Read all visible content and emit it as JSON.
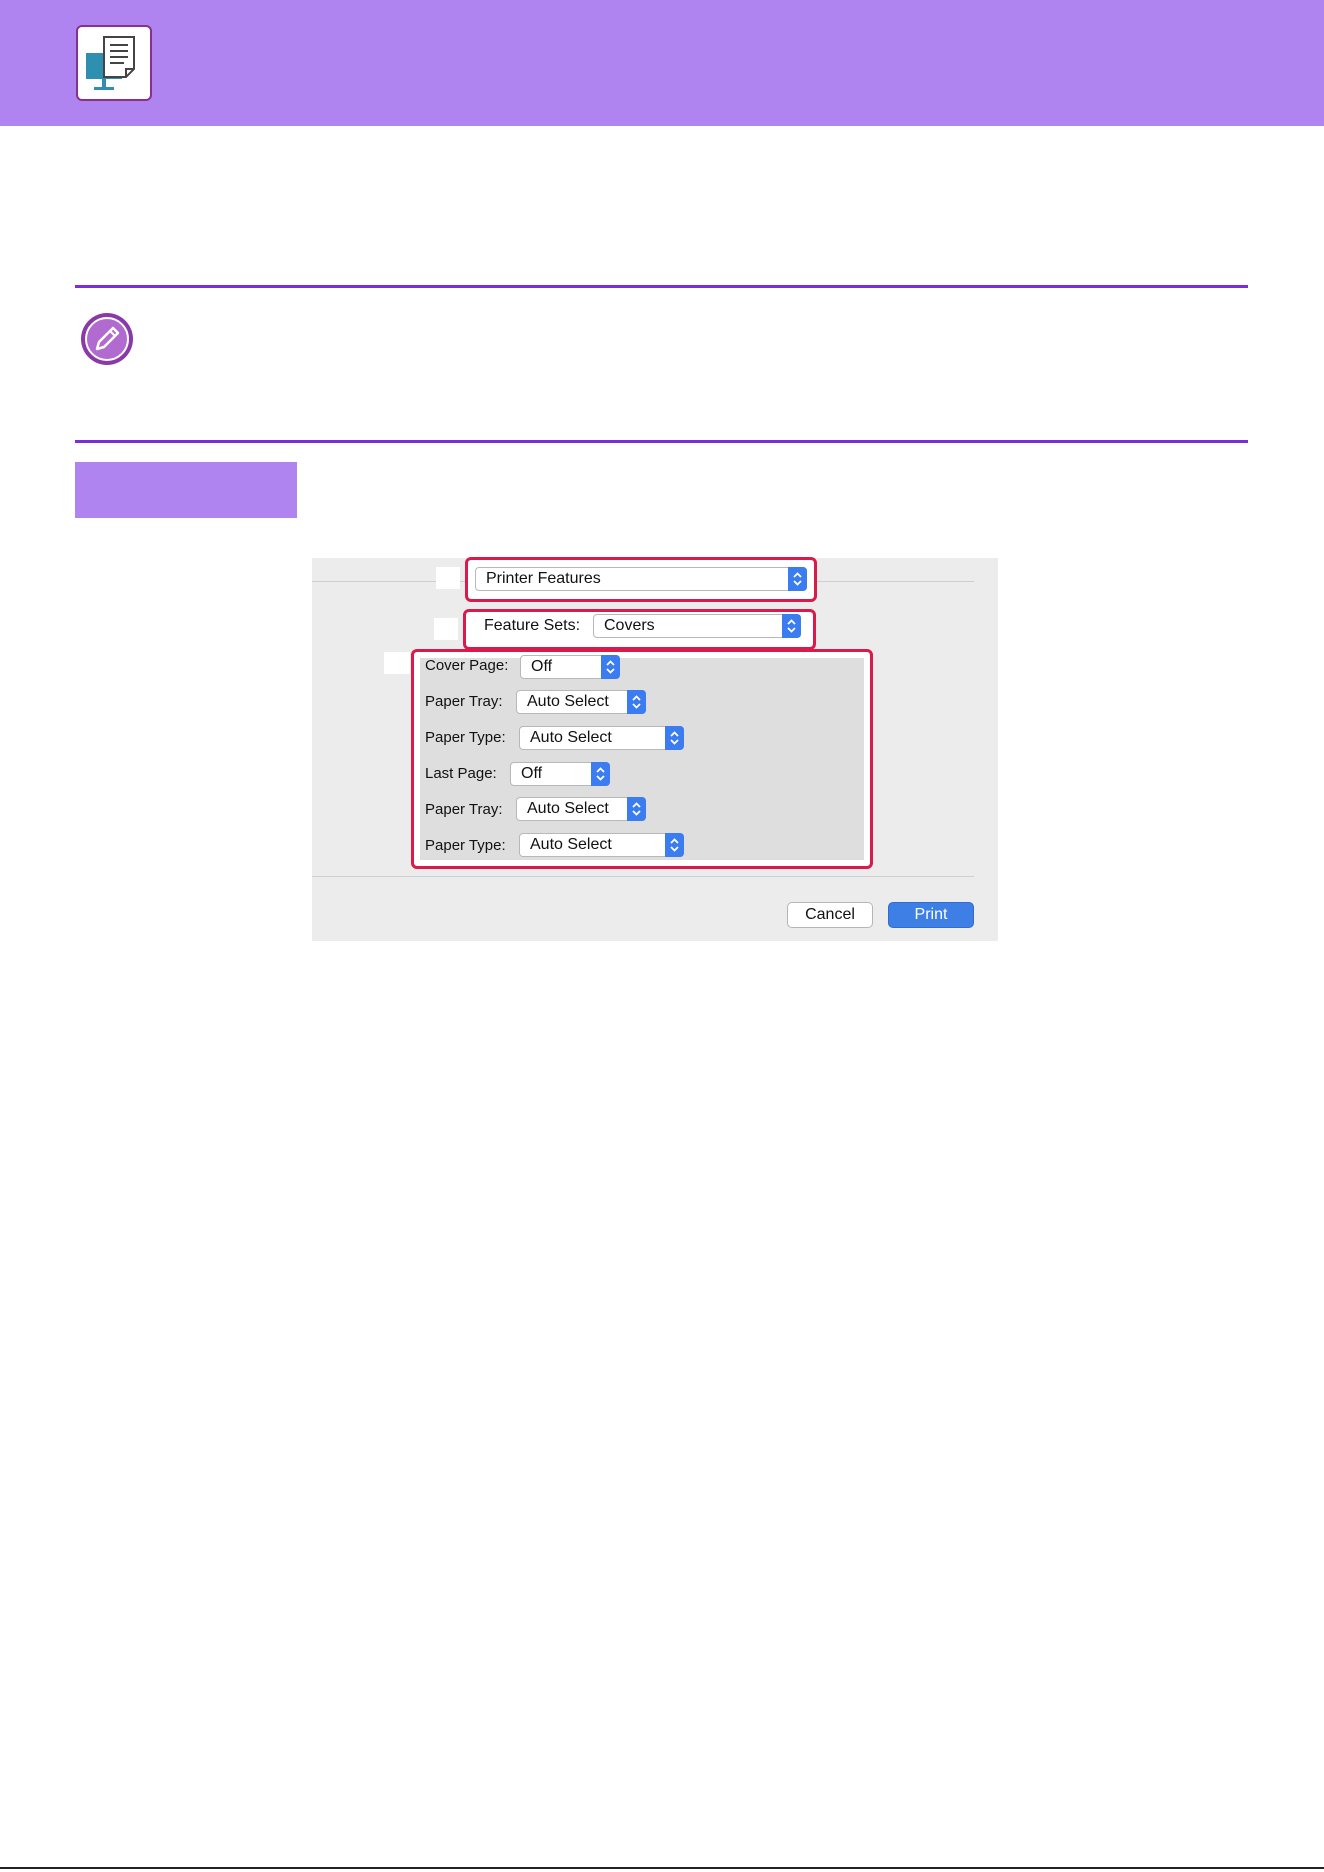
{
  "icons": {
    "header": "computer-print-document-icon",
    "note": "pencil-note-icon",
    "chevron": "up-down-chevron-icon"
  },
  "colors": {
    "header_band": "#b084f0",
    "rule": "#7b2ddb",
    "highlight_frame": "#d81b4a",
    "accent_button": "#3e7fe6"
  },
  "dialog": {
    "printer_features_popup": "Printer Features",
    "feature_sets_label": "Feature Sets:",
    "feature_sets_value": "Covers",
    "rows": [
      {
        "label": "Cover Page:",
        "value": "Off"
      },
      {
        "label": "Paper Tray:",
        "value": "Auto Select"
      },
      {
        "label": "Paper Type:",
        "value": "Auto Select"
      },
      {
        "label": "Last Page:",
        "value": "Off"
      },
      {
        "label": "Paper Tray:",
        "value": "Auto Select"
      },
      {
        "label": "Paper Type:",
        "value": "Auto Select"
      }
    ],
    "cancel_label": "Cancel",
    "print_label": "Print"
  }
}
